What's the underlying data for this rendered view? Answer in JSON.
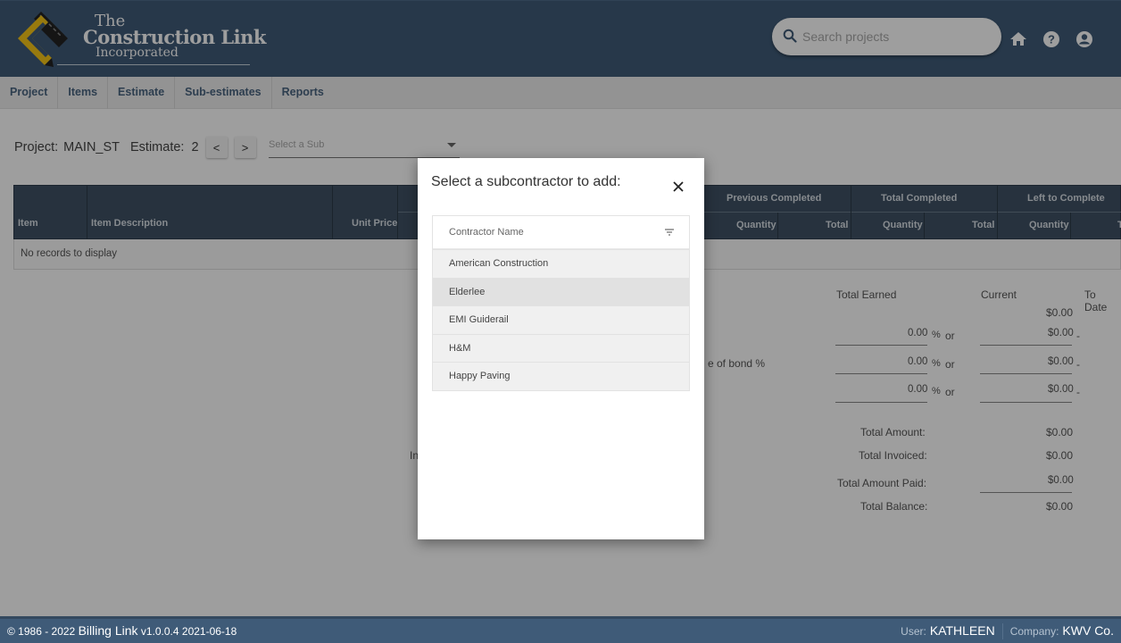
{
  "header": {
    "logo": {
      "line1": "The",
      "line2": "Construction Link",
      "line3": "Incorporated"
    },
    "search_placeholder": "Search projects",
    "icons": [
      "home-icon",
      "help-icon",
      "account-icon"
    ]
  },
  "nav": {
    "items": [
      {
        "label": "Project"
      },
      {
        "label": "Items"
      },
      {
        "label": "Estimate"
      },
      {
        "label": "Sub-estimates"
      },
      {
        "label": "Reports"
      }
    ]
  },
  "toolbar": {
    "project_label": "Project:",
    "project_value": "MAIN_ST",
    "estimate_label": "Estimate:",
    "estimate_value": "2",
    "prev_label": "<",
    "next_label": ">",
    "sub_select_placeholder": "Select a Sub"
  },
  "table": {
    "columns": {
      "item": "Item",
      "item_description": "Item Description",
      "unit_price": "Unit Price"
    },
    "groups": [
      {
        "label": "Previous Completed",
        "sub": [
          "Quantity",
          "Total"
        ]
      },
      {
        "label": "Total Completed",
        "sub": [
          "Quantity",
          "Total"
        ]
      },
      {
        "label": "Left to Complete",
        "sub": [
          "Quantity",
          "T"
        ]
      }
    ],
    "empty_message": "No records to display"
  },
  "summary": {
    "headers": {
      "total_earned": "Total Earned",
      "current": "Current",
      "to_date": "To Date"
    },
    "earned_row_value": "$0.00",
    "partial_label": "e of bond %",
    "rows": [
      {
        "percent": "0.00",
        "pct_sign": "%",
        "or": "or",
        "current": "$0.00",
        "dash": "-"
      },
      {
        "percent": "0.00",
        "pct_sign": "%",
        "or": "or",
        "current": "$0.00",
        "dash": "-"
      },
      {
        "percent": "0.00",
        "pct_sign": "%",
        "or": "or",
        "current": "$0.00",
        "dash": "-"
      }
    ],
    "partial_left_text": "In",
    "totals": [
      {
        "label": "Total Amount:",
        "value": "$0.00"
      },
      {
        "label": "Total Invoiced:",
        "value": "$0.00"
      },
      {
        "label": "Total Amount Paid:",
        "value": "$0.00"
      },
      {
        "label": "Total Balance:",
        "value": "$0.00"
      }
    ]
  },
  "dialog": {
    "title": "Select a subcontractor to add:",
    "column_header": "Contractor Name",
    "contractors": [
      {
        "name": "American Construction"
      },
      {
        "name": "Elderlee"
      },
      {
        "name": "EMI Guiderail"
      },
      {
        "name": "H&M"
      },
      {
        "name": "Happy Paving"
      }
    ],
    "hovered_index": 1
  },
  "footer": {
    "copyright": "© 1986 - 2022",
    "app_name": "Billing Link",
    "version": "v1.0.0.4 2021-06-18",
    "user_label": "User:",
    "user_value": "KATHLEEN",
    "company_label": "Company:",
    "company_value": "KWV Co."
  },
  "colors": {
    "brand": "#3f5b78",
    "accent": "#f5c518",
    "table_header": "#3f5265",
    "nav_text": "#4a6480"
  }
}
